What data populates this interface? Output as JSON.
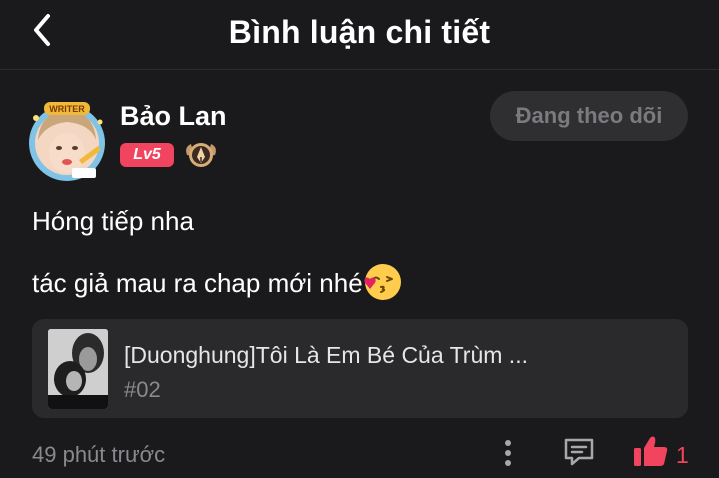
{
  "header": {
    "title": "Bình luận chi tiết",
    "back_icon": "chevron-left-icon"
  },
  "user": {
    "name": "Bảo Lan",
    "level": "Lv5",
    "avatar_frame_text": "WRITER",
    "follow_label": "Đang theo dõi"
  },
  "comment": {
    "lines": [
      "Hóng tiếp nha",
      "tác giả mau ra chap mới nhé"
    ],
    "emoji": "kissing-face-emoji"
  },
  "story": {
    "title": "[Duonghung]Tôi Là Em Bé Của Trùm ...",
    "chapter": "#02"
  },
  "footer": {
    "timestamp": "49 phút trước",
    "like_count": "1",
    "icons": [
      "more-vertical-icon",
      "reply-icon",
      "thumbs-up-icon"
    ]
  },
  "colors": {
    "background": "#1a1a1c",
    "accent": "#f0445f",
    "card": "#2a2a2c",
    "muted": "#8a8a8e"
  }
}
